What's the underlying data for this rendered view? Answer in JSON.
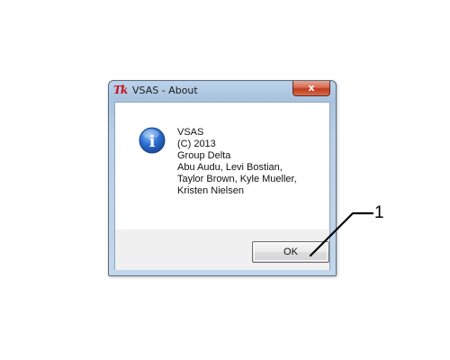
{
  "window": {
    "title": "VSAS - About",
    "app_icon": "tk-feather-icon",
    "app_icon_text": "Tk",
    "close_icon": "close-x-icon",
    "close_glyph": "x"
  },
  "dialog": {
    "icon": "information-icon",
    "icon_glyph": "i",
    "message_lines": [
      "VSAS",
      "(C) 2013",
      "Group Delta",
      "Abu Audu, Levi Bostian,",
      "Taylor Brown, Kyle Mueller,",
      "Kristen Nielsen"
    ],
    "ok_label": "OK"
  },
  "annotation": {
    "callout_label": "1"
  },
  "colors": {
    "title_frame": "#a9c3df",
    "close_button": "#c1391c",
    "info_icon": "#2c6fd1",
    "button_strip": "#f0f0f0"
  }
}
